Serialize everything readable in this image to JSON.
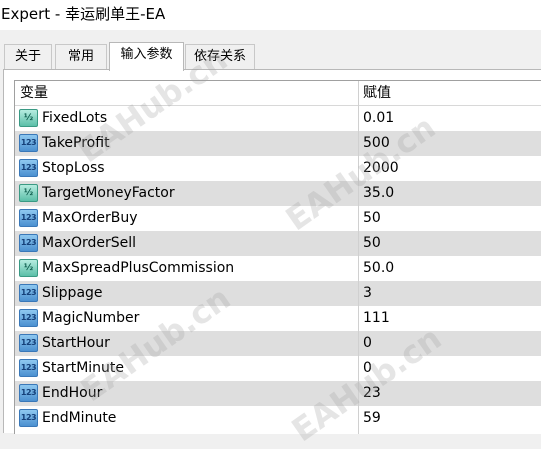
{
  "window": {
    "title": "Expert - 幸运刷单王-EA"
  },
  "tabs": [
    {
      "label": "关于"
    },
    {
      "label": "常用"
    },
    {
      "label": "输入参数",
      "active": true
    },
    {
      "label": "依存关系"
    }
  ],
  "table": {
    "headers": {
      "name": "变量",
      "value": "赋值"
    },
    "rows": [
      {
        "icon": "double-type-icon",
        "name": "FixedLots",
        "value": "0.01"
      },
      {
        "icon": "integer-type-icon",
        "name": "TakeProfit",
        "value": "500"
      },
      {
        "icon": "integer-type-icon",
        "name": "StopLoss",
        "value": "2000"
      },
      {
        "icon": "double-type-icon",
        "name": "TargetMoneyFactor",
        "value": "35.0"
      },
      {
        "icon": "integer-type-icon",
        "name": "MaxOrderBuy",
        "value": "50"
      },
      {
        "icon": "integer-type-icon",
        "name": "MaxOrderSell",
        "value": "50"
      },
      {
        "icon": "double-type-icon",
        "name": "MaxSpreadPlusCommission",
        "value": "50.0"
      },
      {
        "icon": "integer-type-icon",
        "name": "Slippage",
        "value": "3"
      },
      {
        "icon": "integer-type-icon",
        "name": "MagicNumber",
        "value": "111"
      },
      {
        "icon": "integer-type-icon",
        "name": "StartHour",
        "value": "0"
      },
      {
        "icon": "integer-type-icon",
        "name": "StartMinute",
        "value": "0"
      },
      {
        "icon": "integer-type-icon",
        "name": "EndHour",
        "value": "23"
      },
      {
        "icon": "integer-type-icon",
        "name": "EndMinute",
        "value": "59"
      }
    ]
  },
  "icons": {
    "integer_glyph": "123",
    "double_glyph": "½"
  },
  "watermark": {
    "text": "EAHub.cn"
  },
  "colors": {
    "row_alt": "#dedede",
    "icon_int": "#4c90d0",
    "icon_double": "#5cbfa8"
  }
}
